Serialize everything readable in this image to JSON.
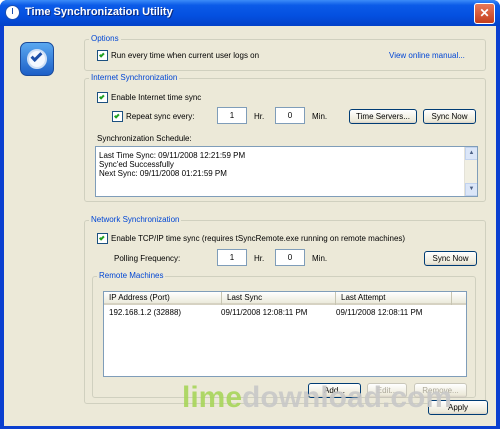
{
  "window": {
    "title": "Time Synchronization Utility",
    "close_glyph": "✕"
  },
  "options": {
    "title": "Options",
    "run_on_logon_label": "Run every time when current user logs on",
    "run_on_logon_checked": true,
    "view_manual_link": "View online manual..."
  },
  "internet_sync": {
    "title": "Internet Synchronization",
    "enable_label": "Enable Internet time sync",
    "enable_checked": true,
    "repeat_label": "Repeat sync every:",
    "repeat_checked": true,
    "hours_value": "1",
    "hours_unit": "Hr.",
    "minutes_value": "0",
    "minutes_unit": "Min.",
    "time_servers_button": "Time Servers...",
    "sync_now_button": "Sync Now",
    "schedule_label": "Synchronization Schedule:",
    "schedule_lines": [
      "Last Time Sync: 09/11/2008 12:21:59 PM",
      "Sync'ed Successfully",
      "Next Sync: 09/11/2008 01:21:59 PM"
    ]
  },
  "network_sync": {
    "title": "Network Synchronization",
    "enable_label": "Enable TCP/IP time sync (requires tSyncRemote.exe running on remote machines)",
    "enable_checked": true,
    "polling_label": "Polling Frequency:",
    "hours_value": "1",
    "hours_unit": "Hr.",
    "minutes_value": "0",
    "minutes_unit": "Min.",
    "sync_now_button": "Sync Now",
    "remote_title": "Remote Machines",
    "columns": [
      "IP Address (Port)",
      "Last Sync",
      "Last Attempt"
    ],
    "rows": [
      [
        "192.168.1.2 (32888)",
        "09/11/2008 12:08:11 PM",
        "09/11/2008 12:08:11 PM"
      ]
    ],
    "add_button": "Add...",
    "edit_button": "Edit...",
    "remove_button": "Remove..."
  },
  "footer": {
    "apply_button": "Apply"
  },
  "watermark": {
    "part1": "lime",
    "part2": "download.com"
  }
}
